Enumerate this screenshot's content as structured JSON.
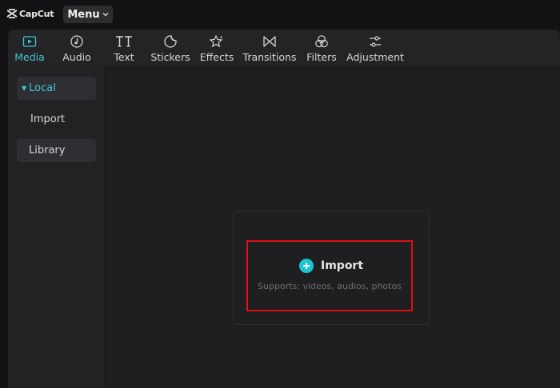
{
  "app": {
    "brand": "CapCut",
    "menu_label": "Menu"
  },
  "toolbar": {
    "tabs": [
      {
        "label": "Media",
        "icon": "media-icon",
        "active": true
      },
      {
        "label": "Audio",
        "icon": "audio-icon",
        "active": false
      },
      {
        "label": "Text",
        "icon": "text-icon",
        "active": false
      },
      {
        "label": "Stickers",
        "icon": "stickers-icon",
        "active": false
      },
      {
        "label": "Effects",
        "icon": "effects-icon",
        "active": false
      },
      {
        "label": "Transitions",
        "icon": "transitions-icon",
        "active": false
      },
      {
        "label": "Filters",
        "icon": "filters-icon",
        "active": false
      },
      {
        "label": "Adjustment",
        "icon": "adjustment-icon",
        "active": false
      }
    ]
  },
  "sidebar": {
    "items": [
      {
        "label": "Local",
        "selected": true
      },
      {
        "label": "Import",
        "selected": false
      },
      {
        "label": "Library",
        "selected": false
      }
    ]
  },
  "dropzone": {
    "import_label": "Import",
    "supports_text": "Supports: videos, audios, photos"
  },
  "colors": {
    "accent": "#3fc6d4",
    "highlight": "#e01010",
    "background": "#1e1e20"
  }
}
